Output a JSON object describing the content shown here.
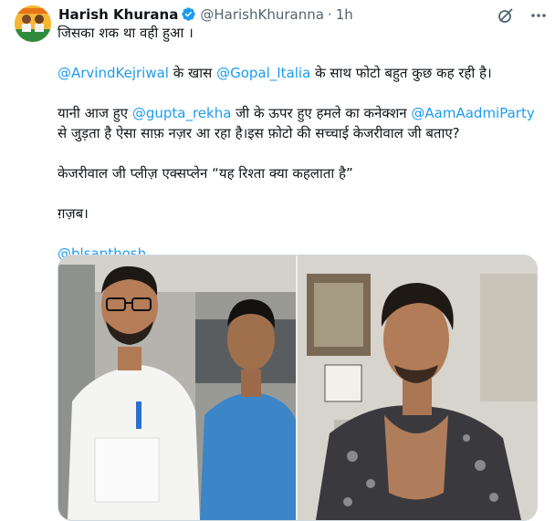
{
  "author": {
    "name": "Harish Khurana",
    "handle": "@HarishKhuranna",
    "separator": "·",
    "time": "1h"
  },
  "icons": {
    "verified": "verified-badge-icon",
    "grok": "grok-icon",
    "more": "more-options-icon"
  },
  "colors": {
    "mention": "#1d9bf0",
    "verified": "#1d9bf0",
    "secondary_text": "#536471"
  },
  "tweet": {
    "line1": "जिसका शक था वही हुआ ।",
    "p2": {
      "mention1": "@ArvindKejriwal",
      "text1": " के खास ",
      "mention2": "@Gopal_Italia",
      "text2": " के साथ फोटो बहुत कुछ कह रही है।"
    },
    "p3": {
      "text1": "यानी आज हुए ",
      "mention1": "@gupta_rekha",
      "text2": " जी के ऊपर हुए हमले का कनेक्शन ",
      "mention2": "@AamAadmiParty",
      "text3": " से जुड़ता है ऐसा साफ़ नज़र आ रहा है।इस फ़ोटो की सच्चाई केजरीवाल जी बताए?"
    },
    "p4": "केजरीवाल जी प्लीज़ एक्सप्लेन “यह रिश्ता क्या कहलाता है”",
    "p5": "ग़ज़ब।",
    "p6_mention": "@blsanthosh"
  }
}
